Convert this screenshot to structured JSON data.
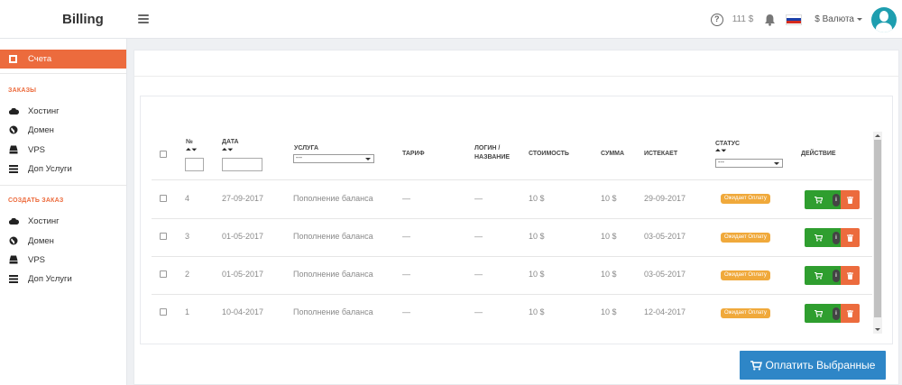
{
  "header": {
    "brand": "Billing",
    "balance": "111 $",
    "currency_label": "$ Валюта",
    "icons": [
      "menu-icon",
      "help-icon",
      "bell-icon",
      "russia-flag-icon",
      "avatar"
    ]
  },
  "sidebar": {
    "active_item": "Счета",
    "sections": [
      {
        "heading": "ЗАКАЗЫ",
        "items": [
          "Хостинг",
          "Домен",
          "VPS",
          "Доп Услуги"
        ]
      },
      {
        "heading": "СОЗДАТЬ ЗАКАЗ",
        "items": [
          "Хостинг",
          "Домен",
          "VPS",
          "Доп Услуги"
        ]
      }
    ]
  },
  "table": {
    "columns": {
      "num": "№",
      "date": "ДАТА",
      "service": "УСЛУГА",
      "tariff": "ТАРИФ",
      "login_1": "ЛОГИН /",
      "login_2": "НАЗВАНИЕ",
      "cost": "СТОИМОСТЬ",
      "sum": "СУММА",
      "expires": "ИСТЕКАЕТ",
      "status": "СТАТУС",
      "action": "ДЕЙСТВИЕ"
    },
    "sort_glyph": "⏶⏷",
    "service_filter": "---",
    "status_filter": "---",
    "rows": [
      {
        "num": "4",
        "date": "27-09-2017",
        "service": "Пополнение баланса",
        "tariff": "—",
        "login": "—",
        "cost": "10 $",
        "sum": "10 $",
        "expires": "29-09-2017",
        "status": "Ожидает Оплату"
      },
      {
        "num": "3",
        "date": "01-05-2017",
        "service": "Пополнение баланса",
        "tariff": "—",
        "login": "—",
        "cost": "10 $",
        "sum": "10 $",
        "expires": "03-05-2017",
        "status": "Ожидает Оплату"
      },
      {
        "num": "2",
        "date": "01-05-2017",
        "service": "Пополнение баланса",
        "tariff": "—",
        "login": "—",
        "cost": "10 $",
        "sum": "10 $",
        "expires": "03-05-2017",
        "status": "Ожидает Оплату"
      },
      {
        "num": "1",
        "date": "10-04-2017",
        "service": "Пополнение баланса",
        "tariff": "—",
        "login": "—",
        "cost": "10 $",
        "sum": "10 $",
        "expires": "12-04-2017",
        "status": "Ожидает Оплату"
      }
    ]
  },
  "pay_button": "Оплатить Выбранные",
  "colors": {
    "accent": "#ec6b3d",
    "pay_button": "#2e86c7",
    "status_badge": "#f0a93b",
    "cart_button": "#2f9e2f",
    "delete_button": "#ec6b3d"
  }
}
